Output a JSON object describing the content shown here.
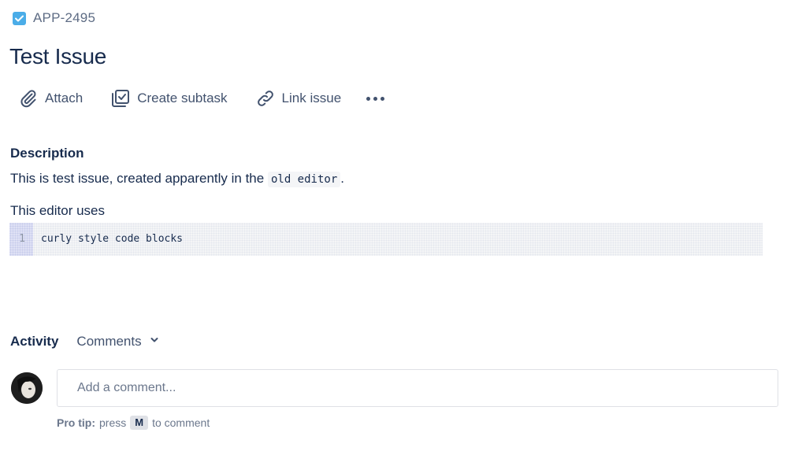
{
  "issue": {
    "key": "APP-2495",
    "type_icon": "checkbox-task-icon",
    "title": "Test Issue"
  },
  "toolbar": {
    "attach_label": "Attach",
    "create_subtask_label": "Create subtask",
    "link_issue_label": "Link issue"
  },
  "description": {
    "heading": "Description",
    "para1_before": "This is test issue, created apparently in the",
    "para1_code": "old editor",
    "para1_after": ".",
    "para2": "This editor uses",
    "code_block": {
      "line_number": "1",
      "code": "curly style code blocks"
    }
  },
  "activity": {
    "label": "Activity",
    "filter_label": "Comments"
  },
  "comment": {
    "placeholder": "Add a comment...",
    "pro_tip_label": "Pro tip:",
    "pro_tip_press": "press",
    "pro_tip_key": "M",
    "pro_tip_suffix": "to comment"
  },
  "colors": {
    "accent": "#4bade8",
    "text_primary": "#172b4d",
    "text_secondary": "#42526e",
    "text_muted": "#6b778c"
  }
}
